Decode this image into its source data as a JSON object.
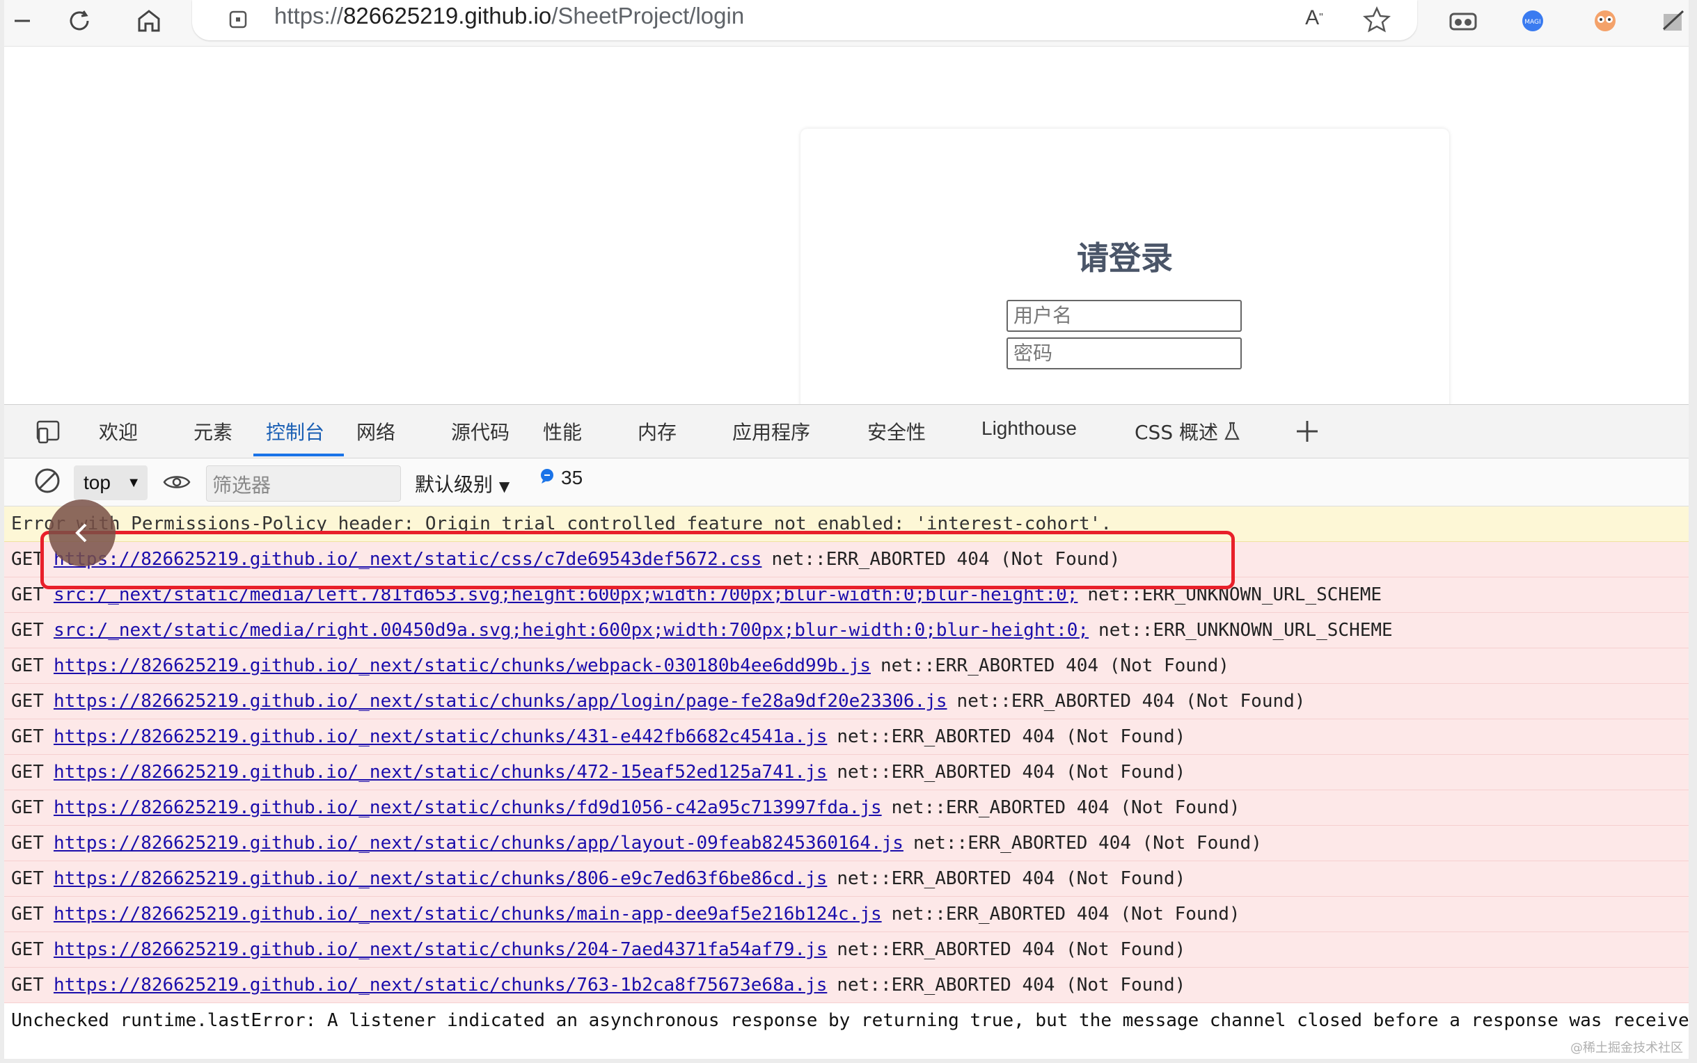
{
  "browser": {
    "url_prefix": "https://",
    "url_host": "826625219.github.io",
    "url_path": "/SheetProject/login"
  },
  "page": {
    "login_title": "请登录",
    "username_placeholder": "用户名",
    "password_placeholder": "密码"
  },
  "devtools": {
    "tabs": [
      "欢迎",
      "元素",
      "控制台",
      "网络",
      "源代码",
      "性能",
      "内存",
      "应用程序",
      "安全性",
      "Lighthouse",
      "CSS 概述"
    ],
    "active_tab": "控制台",
    "context": "top",
    "filter_placeholder": "筛选器",
    "level": "默认级别",
    "message_count": "35"
  },
  "console": {
    "warning_row": "Error with Permissions-Policy header: Origin trial controlled feature not enabled: 'interest-cohort'.",
    "requests": [
      {
        "method": "GET",
        "url": "https://826625219.github.io/_next/static/css/c7de69543def5672.css",
        "status": "net::ERR_ABORTED 404 (Not Found)"
      },
      {
        "method": "GET",
        "url": "src:/_next/static/media/left.781fd653.svg;height:600px;width:700px;blur-width:0;blur-height:0;",
        "status": "net::ERR_UNKNOWN_URL_SCHEME"
      },
      {
        "method": "GET",
        "url": "src:/_next/static/media/right.00450d9a.svg;height:600px;width:700px;blur-width:0;blur-height:0;",
        "status": "net::ERR_UNKNOWN_URL_SCHEME"
      },
      {
        "method": "GET",
        "url": "https://826625219.github.io/_next/static/chunks/webpack-030180b4ee6dd99b.js",
        "status": "net::ERR_ABORTED 404 (Not Found)"
      },
      {
        "method": "GET",
        "url": "https://826625219.github.io/_next/static/chunks/app/login/page-fe28a9df20e23306.js",
        "status": "net::ERR_ABORTED 404 (Not Found)"
      },
      {
        "method": "GET",
        "url": "https://826625219.github.io/_next/static/chunks/431-e442fb6682c4541a.js",
        "status": "net::ERR_ABORTED 404 (Not Found)"
      },
      {
        "method": "GET",
        "url": "https://826625219.github.io/_next/static/chunks/472-15eaf52ed125a741.js",
        "status": "net::ERR_ABORTED 404 (Not Found)"
      },
      {
        "method": "GET",
        "url": "https://826625219.github.io/_next/static/chunks/fd9d1056-c42a95c713997fda.js",
        "status": "net::ERR_ABORTED 404 (Not Found)"
      },
      {
        "method": "GET",
        "url": "https://826625219.github.io/_next/static/chunks/app/layout-09feab8245360164.js",
        "status": "net::ERR_ABORTED 404 (Not Found)"
      },
      {
        "method": "GET",
        "url": "https://826625219.github.io/_next/static/chunks/806-e9c7ed63f6be86cd.js",
        "status": "net::ERR_ABORTED 404 (Not Found)"
      },
      {
        "method": "GET",
        "url": "https://826625219.github.io/_next/static/chunks/main-app-dee9af5e216b124c.js",
        "status": "net::ERR_ABORTED 404 (Not Found)"
      },
      {
        "method": "GET",
        "url": "https://826625219.github.io/_next/static/chunks/204-7aed4371fa54af79.js",
        "status": "net::ERR_ABORTED 404 (Not Found)"
      },
      {
        "method": "GET",
        "url": "https://826625219.github.io/_next/static/chunks/763-1b2ca8f75673e68a.js",
        "status": "net::ERR_ABORTED 404 (Not Found)"
      }
    ],
    "last_row": "Unchecked runtime.lastError: A listener indicated an asynchronous response by returning true, but the message channel closed before a response was received"
  },
  "watermark": "@稀土掘金技术社区"
}
